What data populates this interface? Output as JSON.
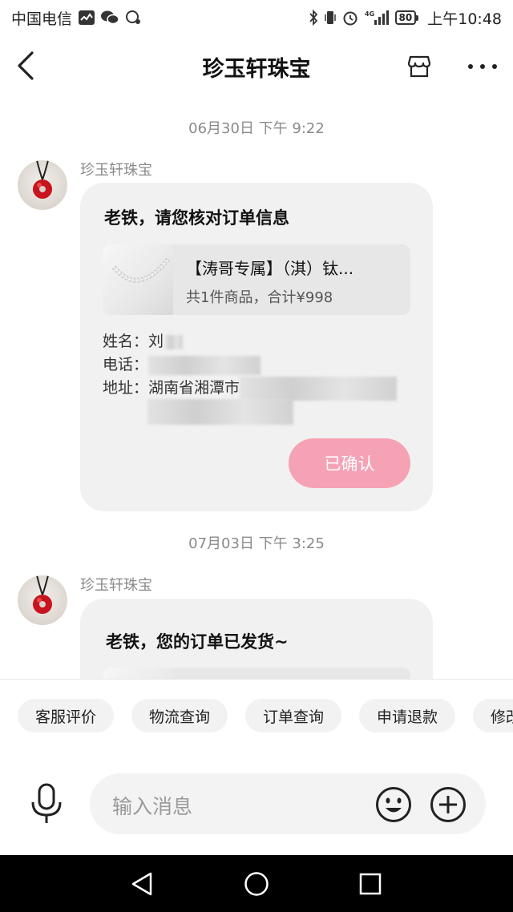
{
  "status_bar": {
    "carrier": "中国电信",
    "network": "4G",
    "battery": "80",
    "time": "上午10:48"
  },
  "header": {
    "title": "珍玉轩珠宝"
  },
  "messages": [
    {
      "timestamp": "06月30日 下午 9:22",
      "sender": "珍玉轩珠宝",
      "title": "老铁，请您核对订单信息",
      "product_name": "【涛哥专属】（淇）钛...",
      "product_summary": "共1件商品，合计¥998",
      "name_label": "姓名：",
      "name_value": "刘",
      "phone_label": "电话：",
      "address_label": "地址：",
      "address_value": "湖南省湘潭市",
      "button_label": "已确认"
    },
    {
      "timestamp": "07月03日 下午 3:25",
      "sender": "珍玉轩珠宝",
      "title": "老铁，您的订单已发货~"
    }
  ],
  "quick_actions": [
    "客服评价",
    "物流查询",
    "订单查询",
    "申请退款",
    "修改"
  ],
  "input": {
    "placeholder": "输入消息"
  },
  "colors": {
    "confirmed_button": "#f6a2b5",
    "bubble_bg": "#f1f1f1",
    "avatar_pendant": "#c8141e"
  }
}
